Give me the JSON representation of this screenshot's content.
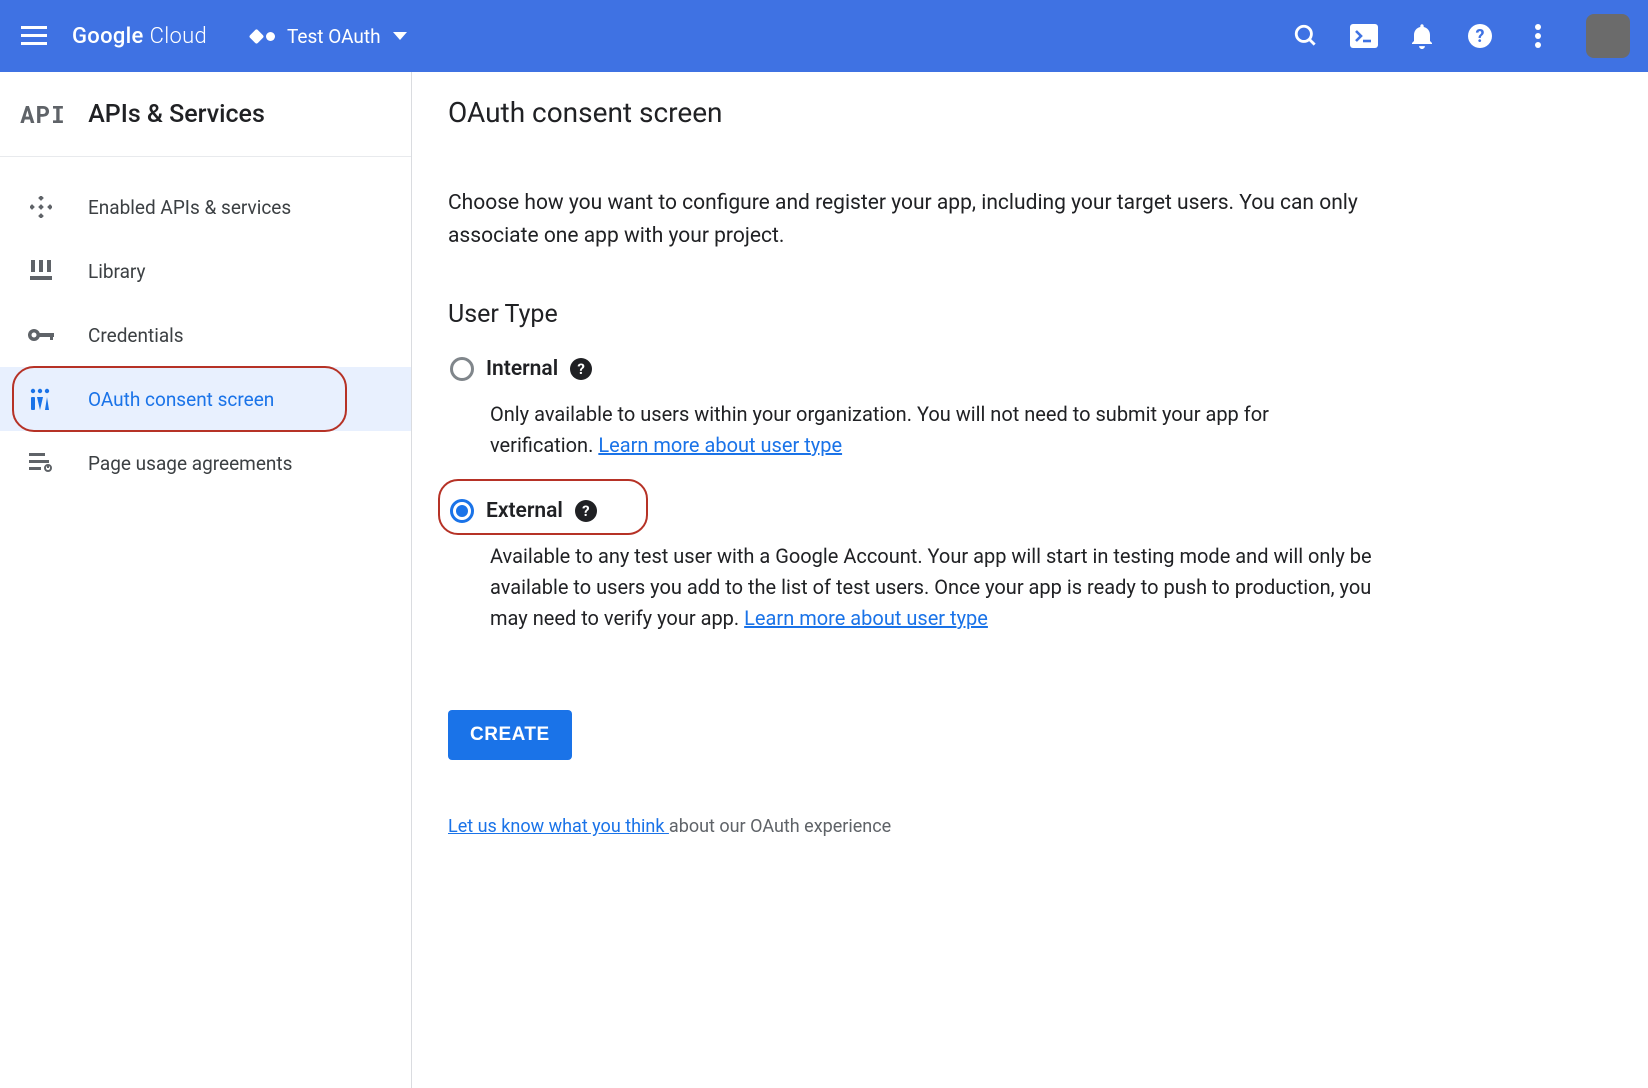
{
  "header": {
    "logo_google": "Google",
    "logo_cloud": "Cloud",
    "project_name": "Test OAuth"
  },
  "sidebar": {
    "badge": "API",
    "title": "APIs & Services",
    "items": [
      {
        "label": "Enabled APIs & services"
      },
      {
        "label": "Library"
      },
      {
        "label": "Credentials"
      },
      {
        "label": "OAuth consent screen"
      },
      {
        "label": "Page usage agreements"
      }
    ]
  },
  "main": {
    "title": "OAuth consent screen",
    "intro": "Choose how you want to configure and register your app, including your target users. You can only associate one app with your project.",
    "section": "User Type",
    "internal": {
      "label": "Internal",
      "desc": "Only available to users within your organization. You will not need to submit your app for verification. ",
      "learn": "Learn more about user type"
    },
    "external": {
      "label": "External",
      "desc": "Available to any test user with a Google Account. Your app will start in testing mode and will only be available to users you add to the list of test users. Once your app is ready to push to production, you may need to verify your app. ",
      "learn": "Learn more about user type"
    },
    "create": "CREATE",
    "feedback_link": "Let us know what you think ",
    "feedback_rest": "about our OAuth experience"
  }
}
